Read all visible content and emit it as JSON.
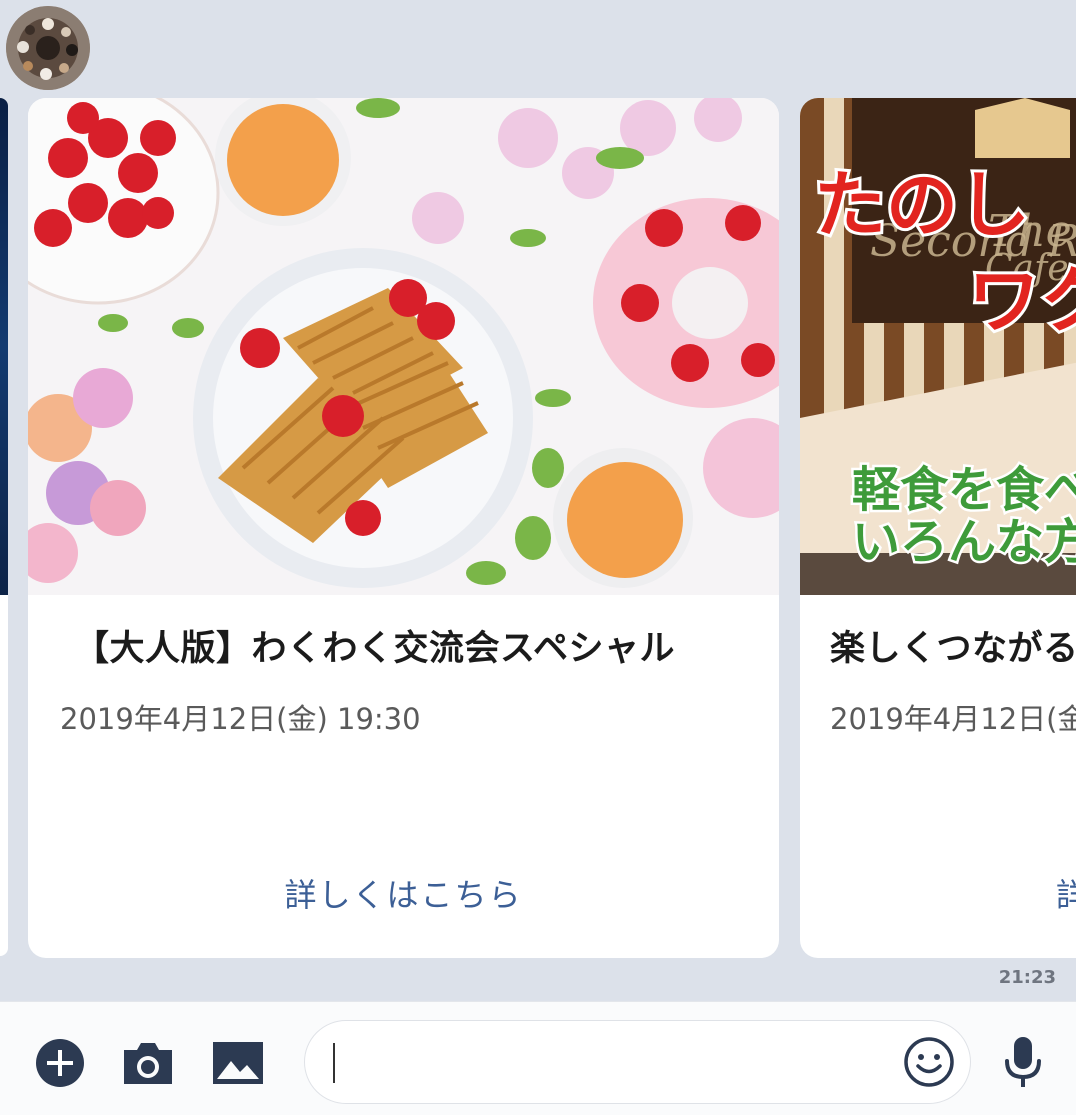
{
  "chat": {
    "timestamp": "21:23",
    "cards": [
      {
        "title": "【大人版】わくわく交流会スペシャル",
        "date": "2019年4月12日(金) 19:30",
        "link_label": "詳しくはこちら"
      },
      {
        "title": "楽しくつながる",
        "date": "2019年4月12日(金",
        "link_label": "詳",
        "image_text": {
          "headline_1": "たのし",
          "headline_2": "ワク",
          "sign_line_1": "The",
          "sign_line_2": "Second R",
          "sign_line_3": "Cafe",
          "body_1": "軽食を食べ",
          "body_2": "いろんな方"
        }
      }
    ]
  },
  "input_bar": {
    "placeholder": "",
    "icons": [
      "plus-icon",
      "camera-icon",
      "image-icon",
      "emoji-icon",
      "mic-icon"
    ],
    "icon_color": "#2c3a52"
  }
}
